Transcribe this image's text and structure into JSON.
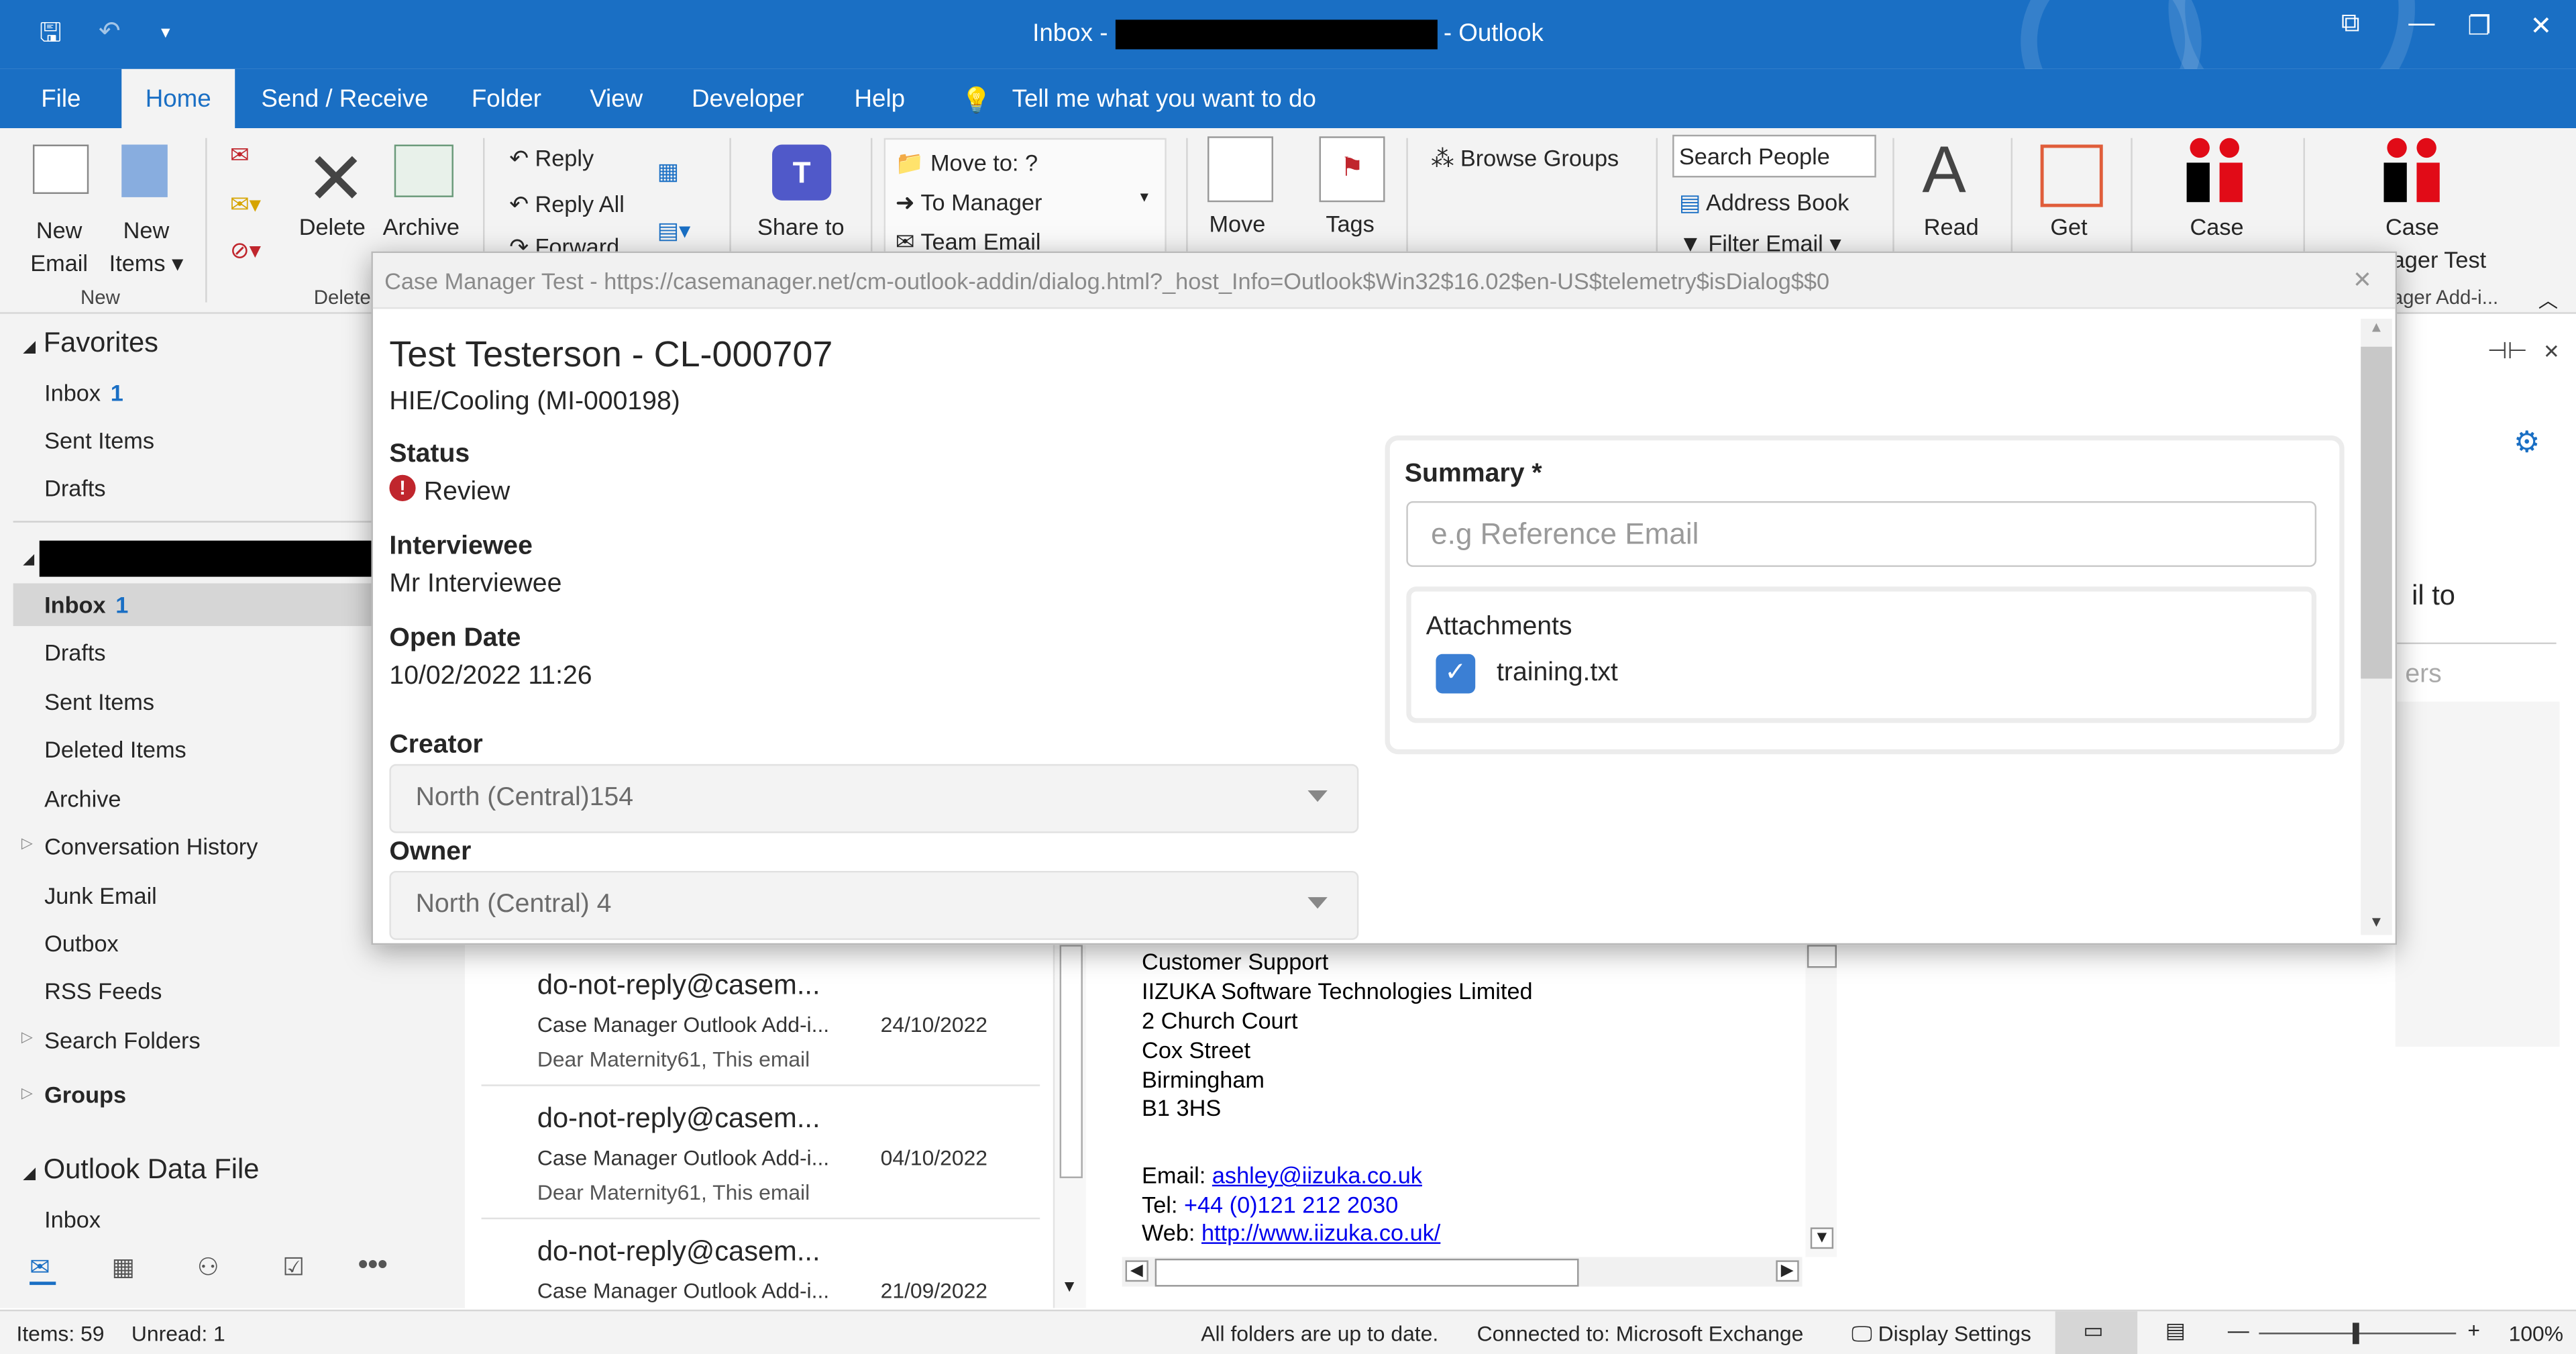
{
  "window": {
    "title_prefix": "Inbox -",
    "title_suffix": "-  Outlook"
  },
  "tabs": [
    "File",
    "Home",
    "Send / Receive",
    "Folder",
    "View",
    "Developer",
    "Help"
  ],
  "tell_me": "Tell me what you want to do",
  "ribbon": {
    "new_email": "New\nEmail",
    "new_email_1": "New",
    "new_email_2": "Email",
    "new_items_1": "New",
    "new_items_2": "Items",
    "group_new": "New",
    "delete": "Delete",
    "archive": "Archive",
    "group_delete": "Delete",
    "reply": "Reply",
    "reply_all": "Reply All",
    "forward": "Forward",
    "share_to": "Share to",
    "move_to": "Move to: ?",
    "to_manager": "To Manager",
    "team_email": "Team Email",
    "move": "Move",
    "tags": "Tags",
    "browse_groups": "Browse Groups",
    "search_people": "Search People",
    "address_book": "Address Book",
    "filter_email": "Filter Email",
    "read": "Read",
    "get": "Get",
    "case": "Case",
    "case2": "Case",
    "case_manager_test": "ager Test",
    "case_addin": "ager Add-i..."
  },
  "nav": {
    "favorites": "Favorites",
    "fav_items": [
      {
        "label": "Inbox",
        "count": "1"
      },
      {
        "label": "Sent Items"
      },
      {
        "label": "Drafts"
      }
    ],
    "folders": [
      {
        "label": "Inbox",
        "count": "1"
      },
      {
        "label": "Drafts"
      },
      {
        "label": "Sent Items"
      },
      {
        "label": "Deleted Items"
      },
      {
        "label": "Archive"
      },
      {
        "label": "Conversation History"
      },
      {
        "label": "Junk Email"
      },
      {
        "label": "Outbox"
      },
      {
        "label": "RSS Feeds"
      },
      {
        "label": "Search Folders"
      }
    ],
    "groups": "Groups",
    "data_file": "Outlook Data File",
    "data_file_inbox": "Inbox"
  },
  "messages": [
    {
      "from": "do-not-reply@casem...",
      "subject": "Case Manager Outlook Add-i...",
      "date": "24/10/2022",
      "preview": "Dear Maternity61,  This email"
    },
    {
      "from": "do-not-reply@casem...",
      "subject": "Case Manager Outlook Add-i...",
      "date": "04/10/2022",
      "preview": "Dear Maternity61,  This email"
    },
    {
      "from": "do-not-reply@casem...",
      "subject": "Case Manager Outlook Add-i...",
      "date": "21/09/2022",
      "preview": ""
    }
  ],
  "reading": {
    "lines": [
      "Customer Support",
      "IIZUKA Software Technologies Limited",
      "2 Church Court",
      "Cox Street",
      "Birmingham",
      "B1 3HS"
    ],
    "email_label": "Email: ",
    "email": "ashley@iizuka.co.uk",
    "tel_label": "Tel: ",
    "tel": "+44 (0)121 212 2030",
    "web_label": "Web: ",
    "web": "http://www.iizuka.co.uk/",
    "side_text": "il to",
    "side_text2": "ers"
  },
  "status": {
    "items": "Items: 59",
    "unread": "Unread: 1",
    "sync": "All folders are up to date.",
    "connected": "Connected to: Microsoft Exchange",
    "display": "Display Settings",
    "zoom": "100%"
  },
  "dialog": {
    "title": "Case Manager Test - https://casemanager.net/cm-outlook-addin/dialog.html?_host_Info=Outlook$Win32$16.02$en-US$telemetry$isDialog$$0",
    "case_title": "Test Testerson - CL-000707",
    "case_sub": "HIE/Cooling (MI-000198)",
    "status_label": "Status",
    "status_value": "Review",
    "interviewee_label": "Interviewee",
    "interviewee_value": "Mr Interviewee",
    "open_date_label": "Open Date",
    "open_date_value": "10/02/2022 11:26",
    "creator_label": "Creator",
    "creator_value": "North (Central)154",
    "owner_label": "Owner",
    "owner_value": "North (Central) 4",
    "summary_label": "Summary *",
    "summary_placeholder": "e.g Reference Email",
    "summary_value": "",
    "attachments_label": "Attachments",
    "attachment_file": "training.txt",
    "attachment_checked": true
  },
  "colors": {
    "accent": "#1a6fc4",
    "status_icon": "#c0262d",
    "checkbox": "#3b7fd4"
  }
}
